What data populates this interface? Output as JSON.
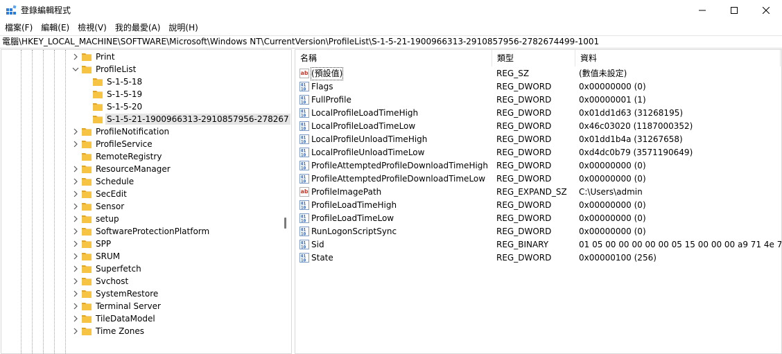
{
  "window": {
    "title": "登錄編輯程式"
  },
  "menu": [
    {
      "label": "檔案(F)"
    },
    {
      "label": "編輯(E)"
    },
    {
      "label": "檢視(V)"
    },
    {
      "label": "我的最愛(A)"
    },
    {
      "label": "說明(H)"
    }
  ],
  "address": {
    "path": "電腦\\HKEY_LOCAL_MACHINE\\SOFTWARE\\Microsoft\\Windows NT\\CurrentVersion\\ProfileList\\S-1-5-21-1900966313-2910857956-2782674499-1001"
  },
  "tree": {
    "items": [
      {
        "label": "Print",
        "expander": "collapsed",
        "depth": 0
      },
      {
        "label": "ProfileList",
        "expander": "expanded",
        "depth": 0
      },
      {
        "label": "S-1-5-18",
        "expander": "none",
        "depth": 1
      },
      {
        "label": "S-1-5-19",
        "expander": "none",
        "depth": 1
      },
      {
        "label": "S-1-5-20",
        "expander": "none",
        "depth": 1
      },
      {
        "label": "S-1-5-21-1900966313-2910857956-278267",
        "expander": "none",
        "depth": 1,
        "selected": true
      },
      {
        "label": "ProfileNotification",
        "expander": "collapsed",
        "depth": 0
      },
      {
        "label": "ProfileService",
        "expander": "collapsed",
        "depth": 0
      },
      {
        "label": "RemoteRegistry",
        "expander": "none",
        "depth": 0
      },
      {
        "label": "ResourceManager",
        "expander": "collapsed",
        "depth": 0
      },
      {
        "label": "Schedule",
        "expander": "collapsed",
        "depth": 0
      },
      {
        "label": "SecEdit",
        "expander": "collapsed",
        "depth": 0
      },
      {
        "label": "Sensor",
        "expander": "collapsed",
        "depth": 0
      },
      {
        "label": "setup",
        "expander": "collapsed",
        "depth": 0
      },
      {
        "label": "SoftwareProtectionPlatform",
        "expander": "collapsed",
        "depth": 0
      },
      {
        "label": "SPP",
        "expander": "collapsed",
        "depth": 0
      },
      {
        "label": "SRUM",
        "expander": "collapsed",
        "depth": 0
      },
      {
        "label": "Superfetch",
        "expander": "collapsed",
        "depth": 0
      },
      {
        "label": "Svchost",
        "expander": "collapsed",
        "depth": 0
      },
      {
        "label": "SystemRestore",
        "expander": "collapsed",
        "depth": 0
      },
      {
        "label": "Terminal Server",
        "expander": "collapsed",
        "depth": 0
      },
      {
        "label": "TileDataModel",
        "expander": "collapsed",
        "depth": 0
      },
      {
        "label": "Time Zones",
        "expander": "collapsed",
        "depth": 0
      }
    ]
  },
  "values": {
    "columns": {
      "name": "名稱",
      "type": "類型",
      "data": "資料"
    },
    "rows": [
      {
        "icon": "string-value-icon",
        "name": "(預設值)",
        "type": "REG_SZ",
        "data": "(數值未設定)"
      },
      {
        "icon": "binary-value-icon",
        "name": "Flags",
        "type": "REG_DWORD",
        "data": "0x00000000 (0)"
      },
      {
        "icon": "binary-value-icon",
        "name": "FullProfile",
        "type": "REG_DWORD",
        "data": "0x00000001 (1)"
      },
      {
        "icon": "binary-value-icon",
        "name": "LocalProfileLoadTimeHigh",
        "type": "REG_DWORD",
        "data": "0x01dd1d63 (31268195)"
      },
      {
        "icon": "binary-value-icon",
        "name": "LocalProfileLoadTimeLow",
        "type": "REG_DWORD",
        "data": "0x46c03020 (1187000352)"
      },
      {
        "icon": "binary-value-icon",
        "name": "LocalProfileUnloadTimeHigh",
        "type": "REG_DWORD",
        "data": "0x01dd1b4a (31267658)"
      },
      {
        "icon": "binary-value-icon",
        "name": "LocalProfileUnloadTimeLow",
        "type": "REG_DWORD",
        "data": "0xd4dc0b79 (3571190649)"
      },
      {
        "icon": "binary-value-icon",
        "name": "ProfileAttemptedProfileDownloadTimeHigh",
        "type": "REG_DWORD",
        "data": "0x00000000 (0)"
      },
      {
        "icon": "binary-value-icon",
        "name": "ProfileAttemptedProfileDownloadTimeLow",
        "type": "REG_DWORD",
        "data": "0x00000000 (0)"
      },
      {
        "icon": "string-value-icon",
        "name": "ProfileImagePath",
        "type": "REG_EXPAND_SZ",
        "data": "C:\\Users\\admin"
      },
      {
        "icon": "binary-value-icon",
        "name": "ProfileLoadTimeHigh",
        "type": "REG_DWORD",
        "data": "0x00000000 (0)"
      },
      {
        "icon": "binary-value-icon",
        "name": "ProfileLoadTimeLow",
        "type": "REG_DWORD",
        "data": "0x00000000 (0)"
      },
      {
        "icon": "binary-value-icon",
        "name": "RunLogonScriptSync",
        "type": "REG_DWORD",
        "data": "0x00000000 (0)"
      },
      {
        "icon": "binary-value-icon",
        "name": "Sid",
        "type": "REG_BINARY",
        "data": "01 05 00 00 00 00 00 05 15 00 00 00 a9 71 4e 7..."
      },
      {
        "icon": "binary-value-icon",
        "name": "State",
        "type": "REG_DWORD",
        "data": "0x00000100 (256)"
      }
    ]
  },
  "colors": {
    "folder": "#f6c343",
    "folder_dark": "#e0a526",
    "string_icon": "#c0392b",
    "binary_icon": "#2c5aa0",
    "selection": "#e5e5e5"
  }
}
